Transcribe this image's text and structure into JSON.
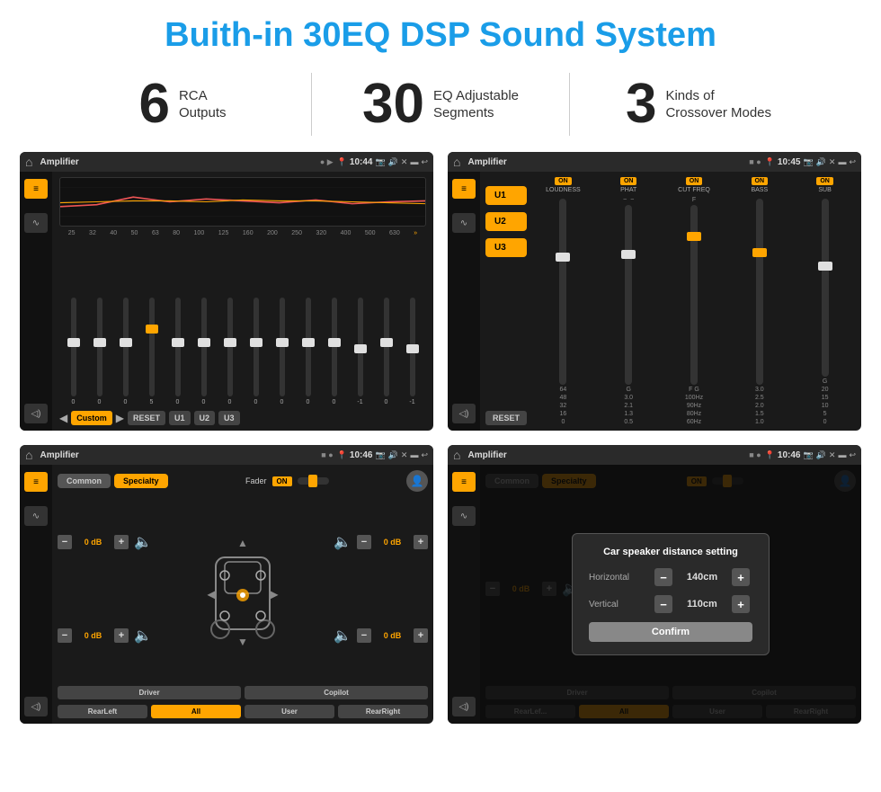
{
  "page": {
    "title": "Buith-in 30EQ DSP Sound System",
    "stats": [
      {
        "number": "6",
        "line1": "RCA",
        "line2": "Outputs"
      },
      {
        "number": "30",
        "line1": "EQ Adjustable",
        "line2": "Segments"
      },
      {
        "number": "3",
        "line1": "Kinds of",
        "line2": "Crossover Modes"
      }
    ]
  },
  "screens": {
    "screen1": {
      "status": {
        "title": "Amplifier",
        "time": "10:44"
      },
      "eq_labels": [
        "25",
        "32",
        "40",
        "50",
        "63",
        "80",
        "100",
        "125",
        "160",
        "200",
        "250",
        "320",
        "400",
        "500",
        "630"
      ],
      "eq_values": [
        "0",
        "0",
        "0",
        "5",
        "0",
        "0",
        "0",
        "0",
        "0",
        "0",
        "0",
        "-1",
        "0",
        "-1"
      ],
      "eq_buttons": [
        "Custom",
        "RESET",
        "U1",
        "U2",
        "U3"
      ]
    },
    "screen2": {
      "status": {
        "title": "Amplifier",
        "time": "10:45"
      },
      "u_buttons": [
        "U1",
        "U2",
        "U3"
      ],
      "controls": [
        {
          "label": "LOUDNESS",
          "on": true
        },
        {
          "label": "PHAT",
          "on": true
        },
        {
          "label": "CUT FREQ",
          "on": true
        },
        {
          "label": "BASS",
          "on": true
        },
        {
          "label": "SUB",
          "on": true
        }
      ],
      "reset": "RESET"
    },
    "screen3": {
      "status": {
        "title": "Amplifier",
        "time": "10:46"
      },
      "tabs": [
        "Common",
        "Specialty"
      ],
      "active_tab": "Specialty",
      "fader_label": "Fader",
      "fader_on": "ON",
      "db_values": [
        "0 dB",
        "0 dB",
        "0 dB",
        "0 dB"
      ],
      "bottom_btns": [
        "Driver",
        "Copilot",
        "RearLeft",
        "All",
        "User",
        "RearRight"
      ]
    },
    "screen4": {
      "status": {
        "title": "Amplifier",
        "time": "10:46"
      },
      "tabs": [
        "Common",
        "Specialty"
      ],
      "active_tab": "Specialty",
      "fader_on": "ON",
      "dialog": {
        "title": "Car speaker distance setting",
        "horizontal_label": "Horizontal",
        "horizontal_val": "140cm",
        "vertical_label": "Vertical",
        "vertical_val": "110cm",
        "confirm": "Confirm"
      },
      "db_values": [
        "0 dB",
        "0 dB"
      ],
      "bottom_btns": [
        "Driver",
        "Copilot",
        "RearLef...",
        "All",
        "User",
        "RearRight"
      ]
    }
  }
}
